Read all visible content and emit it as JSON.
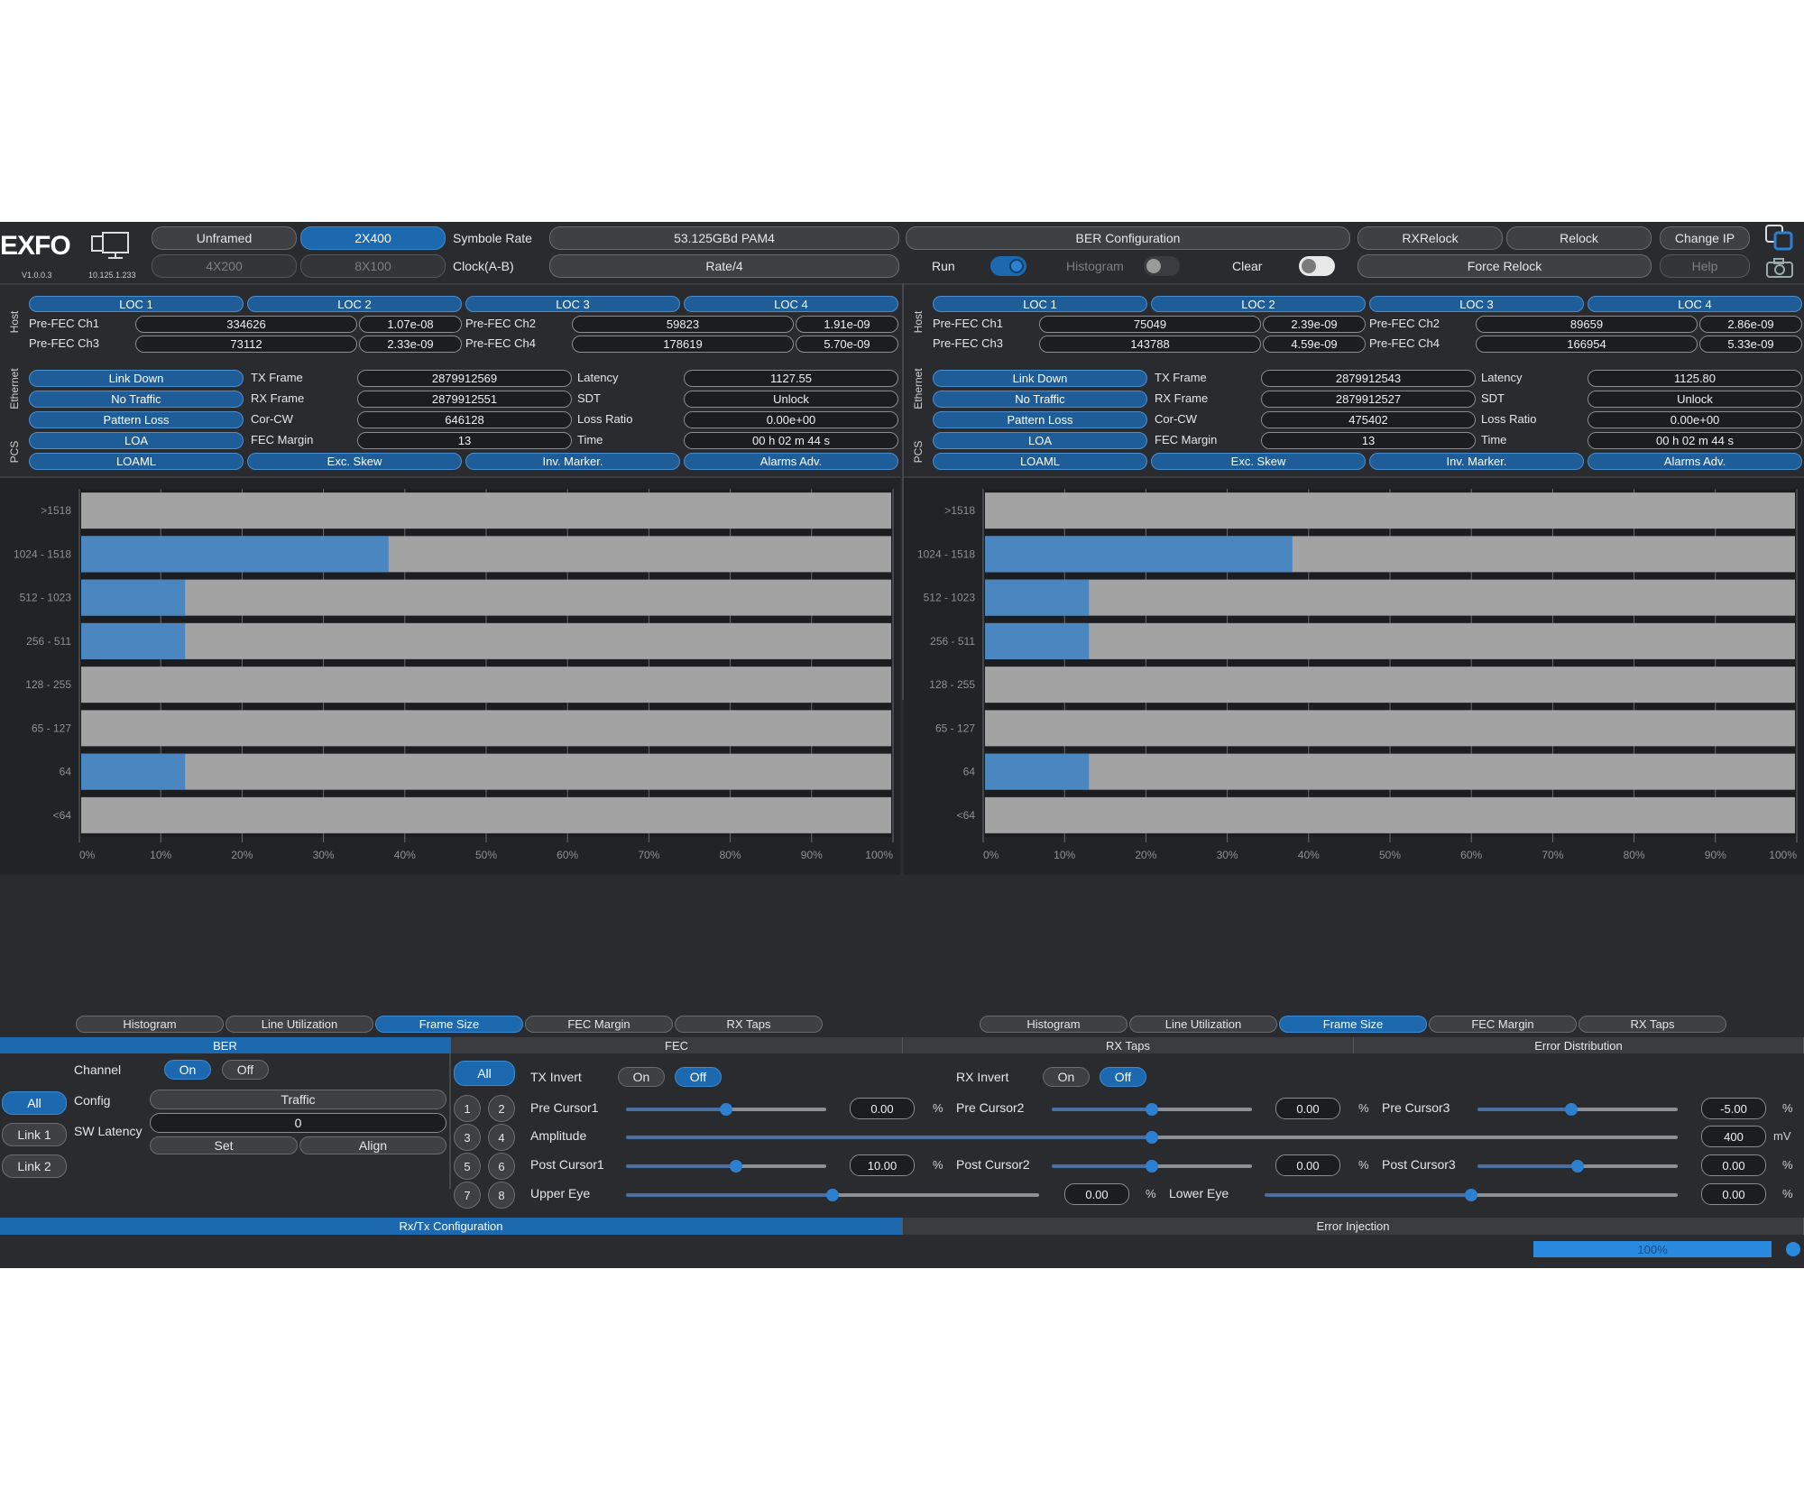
{
  "brand": {
    "logo": "EXFO",
    "version": "V1.0.0.3",
    "ip": "10.125.1.233"
  },
  "toolbar": {
    "modes": [
      "Unframed",
      "2X400",
      "4X200",
      "8X100"
    ],
    "symbol_rate_label": "Symbole Rate",
    "symbol_rate_value": "53.125GBd PAM4",
    "clock_label": "Clock(A-B)",
    "clock_value": "Rate/4",
    "ber_config": "BER Configuration",
    "run_label": "Run",
    "histogram_label": "Histogram",
    "clear_label": "Clear",
    "rxrelock": "RXRelock",
    "relock": "Relock",
    "force_relock": "Force Relock",
    "change_ip": "Change IP",
    "help": "Help"
  },
  "section_labels": {
    "host": "Host",
    "ethernet": "Ethernet",
    "pcs": "PCS"
  },
  "panels": [
    {
      "locs": [
        "LOC 1",
        "LOC 2",
        "LOC 3",
        "LOC 4"
      ],
      "fec": [
        {
          "label": "Pre-FEC Ch1",
          "count": "334626",
          "ber": "1.07e-08"
        },
        {
          "label": "Pre-FEC Ch2",
          "count": "59823",
          "ber": "1.91e-09"
        },
        {
          "label": "Pre-FEC Ch3",
          "count": "73112",
          "ber": "2.33e-09"
        },
        {
          "label": "Pre-FEC Ch4",
          "count": "178619",
          "ber": "5.70e-09"
        }
      ],
      "alarms": [
        "Link Down",
        "No Traffic",
        "Pattern Loss",
        "LOA"
      ],
      "stats_a": [
        {
          "label": "TX Frame",
          "value": "2879912569"
        },
        {
          "label": "RX Frame",
          "value": "2879912551"
        },
        {
          "label": "Cor-CW",
          "value": "646128"
        },
        {
          "label": "FEC Margin",
          "value": "13"
        }
      ],
      "stats_b": [
        {
          "label": "Latency",
          "value": "1127.55"
        },
        {
          "label": "SDT",
          "value": "Unlock"
        },
        {
          "label": "Loss Ratio",
          "value": "0.00e+00"
        },
        {
          "label": "Time",
          "value": "00 h 02 m 44 s"
        }
      ],
      "pcs": [
        "LOAML",
        "Exc. Skew",
        "Inv. Marker.",
        "Alarms Adv."
      ],
      "tabs": [
        "Histogram",
        "Line Utilization",
        "Frame Size",
        "FEC Margin",
        "RX Taps"
      ],
      "active_tab": 2
    },
    {
      "locs": [
        "LOC 1",
        "LOC 2",
        "LOC 3",
        "LOC 4"
      ],
      "fec": [
        {
          "label": "Pre-FEC Ch1",
          "count": "75049",
          "ber": "2.39e-09"
        },
        {
          "label": "Pre-FEC Ch2",
          "count": "89659",
          "ber": "2.86e-09"
        },
        {
          "label": "Pre-FEC Ch3",
          "count": "143788",
          "ber": "4.59e-09"
        },
        {
          "label": "Pre-FEC Ch4",
          "count": "166954",
          "ber": "5.33e-09"
        }
      ],
      "alarms": [
        "Link Down",
        "No Traffic",
        "Pattern Loss",
        "LOA"
      ],
      "stats_a": [
        {
          "label": "TX Frame",
          "value": "2879912543"
        },
        {
          "label": "RX Frame",
          "value": "2879912527"
        },
        {
          "label": "Cor-CW",
          "value": "475402"
        },
        {
          "label": "FEC Margin",
          "value": "13"
        }
      ],
      "stats_b": [
        {
          "label": "Latency",
          "value": "1125.80"
        },
        {
          "label": "SDT",
          "value": "Unlock"
        },
        {
          "label": "Loss Ratio",
          "value": "0.00e+00"
        },
        {
          "label": "Time",
          "value": "00 h 02 m 44 s"
        }
      ],
      "pcs": [
        "LOAML",
        "Exc. Skew",
        "Inv. Marker.",
        "Alarms Adv."
      ],
      "tabs": [
        "Histogram",
        "Line Utilization",
        "Frame Size",
        "FEC Margin",
        "RX Taps"
      ],
      "active_tab": 2
    }
  ],
  "chart_data": [
    {
      "type": "bar",
      "orientation": "horizontal",
      "categories": [
        ">1518",
        "1024 - 1518",
        "512 - 1023",
        "256 - 511",
        "128 - 255",
        "65 - 127",
        "64",
        "<64"
      ],
      "values": [
        0,
        38,
        13,
        13,
        0,
        0,
        13,
        0
      ],
      "x_ticks": [
        "0%",
        "10%",
        "20%",
        "30%",
        "40%",
        "50%",
        "60%",
        "70%",
        "80%",
        "90%",
        "100%"
      ],
      "xlim": [
        0,
        100
      ],
      "bar_color": "#4a86c0",
      "track_color": "#a3a3a3"
    },
    {
      "type": "bar",
      "orientation": "horizontal",
      "categories": [
        ">1518",
        "1024 - 1518",
        "512 - 1023",
        "256 - 511",
        "128 - 255",
        "65 - 127",
        "64",
        "<64"
      ],
      "values": [
        0,
        38,
        13,
        13,
        0,
        0,
        13,
        0
      ],
      "x_ticks": [
        "0%",
        "10%",
        "20%",
        "30%",
        "40%",
        "50%",
        "60%",
        "70%",
        "80%",
        "90%",
        "100%"
      ],
      "xlim": [
        0,
        100
      ],
      "bar_color": "#4a86c0",
      "track_color": "#a3a3a3"
    }
  ],
  "bottom_headers": [
    "BER",
    "FEC",
    "RX Taps",
    "Error Distribution"
  ],
  "ber": {
    "channel_label": "Channel",
    "on": "On",
    "off": "Off",
    "links": [
      "All",
      "Link 1",
      "Link 2"
    ],
    "config_label": "Config",
    "config_value": "Traffic",
    "sw_latency_label": "SW Latency",
    "sw_latency_value": "0",
    "set": "Set",
    "align": "Align"
  },
  "fec_panel": {
    "all": "All",
    "lanes": [
      "1",
      "2",
      "3",
      "4",
      "5",
      "6",
      "7",
      "8"
    ],
    "tx_invert": "TX Invert",
    "rx_invert": "RX Invert",
    "on": "On",
    "off": "Off",
    "pre_cursor1": {
      "label": "Pre Cursor1",
      "value": "0.00",
      "unit": "%",
      "level": 0.5
    },
    "pre_cursor2": {
      "label": "Pre Cursor2",
      "value": "0.00",
      "unit": "%",
      "level": 0.5
    },
    "pre_cursor3": {
      "label": "Pre Cursor3",
      "value": "-5.00",
      "unit": "%",
      "level": 0.47
    },
    "amplitude": {
      "label": "Amplitude",
      "value": "400",
      "unit": "mV",
      "level": 0.5
    },
    "post_cursor1": {
      "label": "Post Cursor1",
      "value": "10.00",
      "unit": "%",
      "level": 0.55
    },
    "post_cursor2": {
      "label": "Post Cursor2",
      "value": "0.00",
      "unit": "%",
      "level": 0.5
    },
    "post_cursor3": {
      "label": "Post Cursor3",
      "value": "0.00",
      "unit": "%",
      "level": 0.5
    },
    "upper_eye": {
      "label": "Upper Eye",
      "value": "0.00",
      "unit": "%",
      "level": 0.5
    },
    "lower_eye": {
      "label": "Lower Eye",
      "value": "0.00",
      "unit": "%",
      "level": 0.5
    }
  },
  "footer": {
    "tabs": [
      "Rx/Tx Configuration",
      "Error Injection"
    ],
    "progress": "100%",
    "progress_value": 1.0
  },
  "colors": {
    "accent": "#1c69b0",
    "bar": "#4a86c0",
    "track": "#a3a3a3",
    "background": "#2a2b2e"
  }
}
